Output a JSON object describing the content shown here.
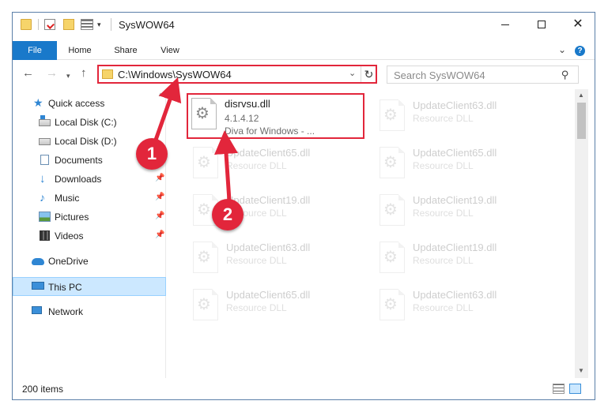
{
  "window": {
    "title": "SysWOW64",
    "minimize_icon": "minimize-icon",
    "maximize_icon": "maximize-icon",
    "close_glyph": "✕"
  },
  "ribbon": {
    "tabs": [
      {
        "label": "File",
        "active": true
      },
      {
        "label": "Home"
      },
      {
        "label": "Share"
      },
      {
        "label": "View"
      }
    ],
    "help_glyph": "?",
    "expand_glyph": "⌄"
  },
  "nav": {
    "back_glyph": "←",
    "forward_glyph": "→",
    "recent_glyph": "▾",
    "up_glyph": "↑",
    "address": "C:\\Windows\\SysWOW64",
    "address_drop_glyph": "⌄",
    "refresh_glyph": "↻",
    "search_placeholder": "Search SysWOW64",
    "search_glyph": "⚲"
  },
  "sidebar": {
    "items": [
      {
        "label": "Quick access",
        "icon": "star-icon"
      },
      {
        "label": "Local Disk (C:)",
        "icon": "drive-icon"
      },
      {
        "label": "Local Disk (D:)",
        "icon": "drive-icon"
      },
      {
        "label": "Documents",
        "icon": "documents-icon"
      },
      {
        "label": "Downloads",
        "icon": "download-icon",
        "pinned": true
      },
      {
        "label": "Music",
        "icon": "music-icon",
        "pinned": true
      },
      {
        "label": "Pictures",
        "icon": "pictures-icon",
        "pinned": true
      },
      {
        "label": "Videos",
        "icon": "videos-icon",
        "pinned": true
      },
      {
        "label": "OneDrive",
        "icon": "cloud-icon"
      },
      {
        "label": "This PC",
        "icon": "computer-icon",
        "selected": true
      },
      {
        "label": "Network",
        "icon": "network-icon"
      }
    ],
    "pin_glyph": "📌"
  },
  "files": [
    {
      "name": "disrvsu.dll",
      "line1": "4.1.4.12",
      "line2": "Diva for Windows - ...",
      "highlighted": true
    },
    {
      "name": "UpdateClient63.dll",
      "line1": "Resource DLL"
    },
    {
      "name": "UpdateClient65.dll",
      "line1": "Resource DLL"
    },
    {
      "name": "UpdateClient65.dll",
      "line1": "Resource DLL"
    },
    {
      "name": "UpdateClient19.dll",
      "line1": "Resource DLL"
    },
    {
      "name": "UpdateClient19.dll",
      "line1": "Resource DLL"
    },
    {
      "name": "UpdateClient63.dll",
      "line1": "Resource DLL"
    },
    {
      "name": "UpdateClient19.dll",
      "line1": "Resource DLL"
    },
    {
      "name": "UpdateClient65.dll",
      "line1": "Resource DLL"
    },
    {
      "name": "UpdateClient63.dll",
      "line1": "Resource DLL"
    }
  ],
  "status": {
    "item_count": "200 items"
  },
  "annotations": {
    "step1": "1",
    "step2": "2",
    "color": "#e2263b"
  },
  "colors": {
    "accent": "#1979ca",
    "selection": "#cce8ff"
  }
}
